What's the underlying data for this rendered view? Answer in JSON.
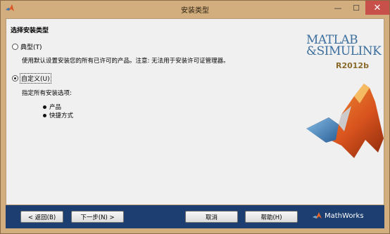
{
  "window": {
    "title": "安装类型",
    "minimize_label": "—",
    "maximize_label": "☐",
    "close_label": "✕"
  },
  "heading": "选择安装类型",
  "options": [
    {
      "label": "典型(T)",
      "checked": false,
      "description": "使用默认设置安装您的所有已许可的产品。注意: 无法用于安装许可证管理器。"
    },
    {
      "label": "自定义(U)",
      "checked": true,
      "description": "指定所有安装选项:"
    }
  ],
  "custom_items": [
    "产品",
    "快捷方式"
  ],
  "branding": {
    "logo_line1": "MATLAB",
    "logo_line2": "&SIMULINK",
    "version": "R2012b",
    "footer_logo": "MathWorks",
    "accent_color": "#3d6f9e"
  },
  "buttons": {
    "back": "< 返回(B)",
    "next": "下一步(N) >",
    "cancel": "取消",
    "help": "帮助(H)"
  }
}
